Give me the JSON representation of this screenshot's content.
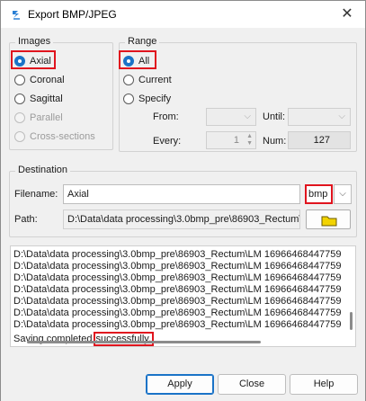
{
  "window": {
    "title": "Export BMP/JPEG",
    "close_glyph": "✕"
  },
  "images_group": {
    "title": "Images",
    "options": [
      {
        "label": "Axial",
        "checked": true,
        "disabled": false
      },
      {
        "label": "Coronal",
        "checked": false,
        "disabled": false
      },
      {
        "label": "Sagittal",
        "checked": false,
        "disabled": false
      },
      {
        "label": "Parallel",
        "checked": false,
        "disabled": true
      },
      {
        "label": "Cross-sections",
        "checked": false,
        "disabled": true
      }
    ]
  },
  "range_group": {
    "title": "Range",
    "options": [
      {
        "label": "All",
        "checked": true
      },
      {
        "label": "Current",
        "checked": false
      },
      {
        "label": "Specify",
        "checked": false
      }
    ],
    "from_label": "From:",
    "until_label": "Until:",
    "every_label": "Every:",
    "every_value": "1",
    "num_label": "Num:",
    "num_value": "127"
  },
  "destination_group": {
    "title": "Destination",
    "filename_label": "Filename:",
    "filename_value": "Axial",
    "format_value": "bmp",
    "path_label": "Path:",
    "path_value": "D:\\Data\\data processing\\3.0bmp_pre\\86903_Rectum\\"
  },
  "log": {
    "lines": [
      "D:\\Data\\data processing\\3.0bmp_pre\\86903_Rectum\\LM 16966468447759",
      "D:\\Data\\data processing\\3.0bmp_pre\\86903_Rectum\\LM 16966468447759",
      "D:\\Data\\data processing\\3.0bmp_pre\\86903_Rectum\\LM 16966468447759",
      "D:\\Data\\data processing\\3.0bmp_pre\\86903_Rectum\\LM 16966468447759",
      "D:\\Data\\data processing\\3.0bmp_pre\\86903_Rectum\\LM 16966468447759",
      "D:\\Data\\data processing\\3.0bmp_pre\\86903_Rectum\\LM 16966468447759",
      "D:\\Data\\data processing\\3.0bmp_pre\\86903_Rectum\\LM 16966468447759"
    ],
    "status_prefix": "Saving completed ",
    "status_highlight": "successfully."
  },
  "buttons": {
    "apply": "Apply",
    "close": "Close",
    "help": "Help"
  },
  "colors": {
    "accent": "#1a73c7",
    "highlight_border": "#e0141e",
    "folder": "#f2d300"
  }
}
